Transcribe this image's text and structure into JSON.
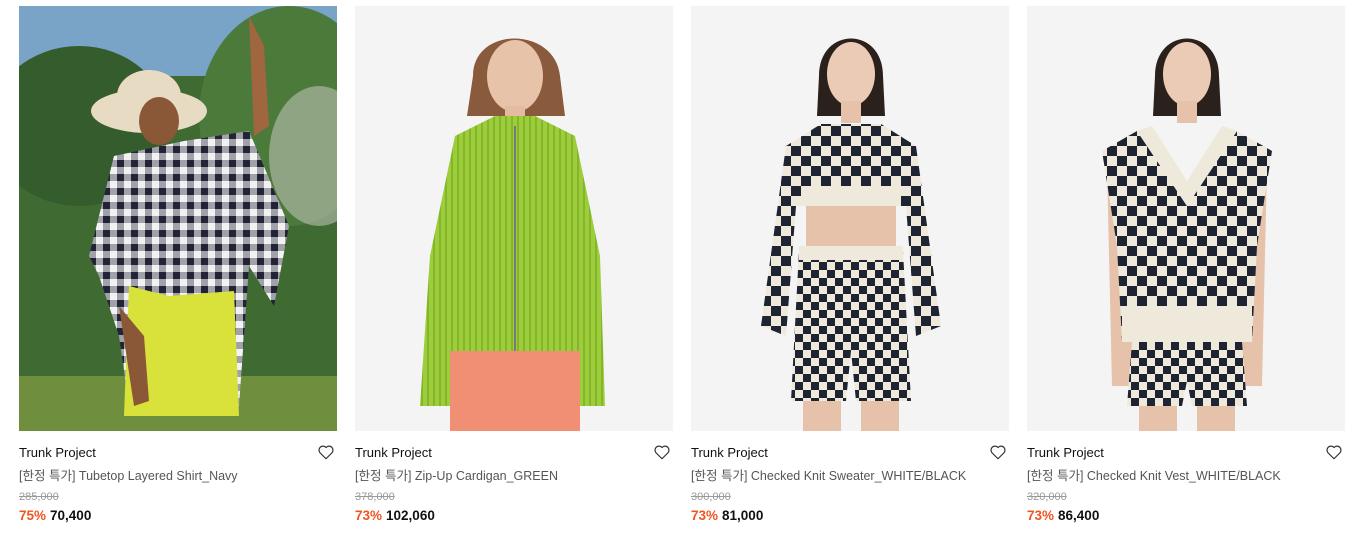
{
  "products": [
    {
      "brand": "Trunk Project",
      "name": "[한정 특가] Tubetop Layered Shirt_Navy",
      "original_price": "285,000",
      "discount": "75%",
      "sale_price": "70,400",
      "image": "model-outdoor-gingham-shirt"
    },
    {
      "brand": "Trunk Project",
      "name": "[한정 특가] Zip-Up Cardigan_GREEN",
      "original_price": "378,000",
      "discount": "73%",
      "sale_price": "102,060",
      "image": "model-green-zip-cardigan"
    },
    {
      "brand": "Trunk Project",
      "name": "[한정 특가] Checked Knit Sweater_WHITE/BLACK",
      "original_price": "300,000",
      "discount": "73%",
      "sale_price": "81,000",
      "image": "model-checked-knit-sweater"
    },
    {
      "brand": "Trunk Project",
      "name": "[한정 특가] Checked Knit Vest_WHITE/BLACK",
      "original_price": "320,000",
      "discount": "73%",
      "sale_price": "86,400",
      "image": "model-checked-knit-vest"
    }
  ],
  "colors": {
    "discount": "#f0541e",
    "text": "#111111",
    "muted": "#9a9a9a"
  }
}
